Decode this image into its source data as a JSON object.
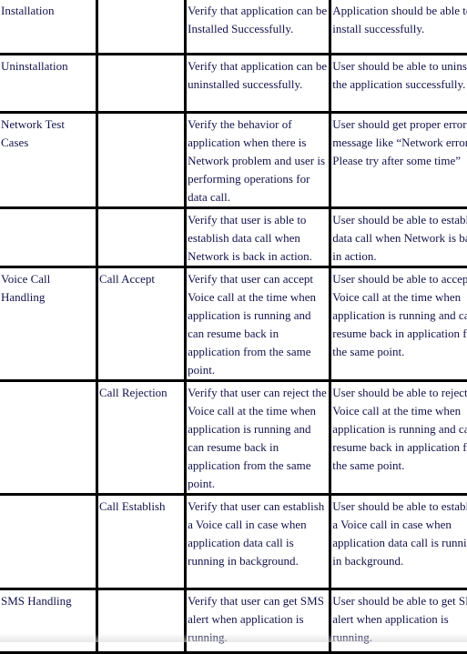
{
  "table": {
    "rows": [
      {
        "module": "Installation",
        "sub": "",
        "test": "Verify that application can be Installed Successfully.",
        "expected": "Application should be able to install successfully."
      },
      {
        "module": "Uninstallation",
        "sub": "",
        "test": "Verify that application can be uninstalled successfully.",
        "expected": "User should be able to uninstall the application successfully."
      },
      {
        "module": "Network Test Cases",
        "sub": "",
        "test": "Verify the behavior of application when there is Network problem and user is performing operations for data call.",
        "expected": "User should get proper error message like “Network error. Please try after some time”"
      },
      {
        "module": "",
        "sub": "",
        "test": "Verify that user is able to establish data call when Network is back in action.",
        "expected": "User should be able to establish data call when Network is back in action."
      },
      {
        "module": "Voice Call Handling",
        "sub": "Call Accept",
        "test": "Verify that user can accept Voice call at the time when application is running and can resume back in application from the same point.",
        "expected": "User should be able to accept Voice call at the time when application is running and can resume back in application from the same point."
      },
      {
        "module": "",
        "sub": "Call Rejection",
        "test": "Verify that user can reject the Voice call at the time when application is running and can resume back in application from the same point.",
        "expected": "User should be able to reject the Voice call at the time when application is running and can resume back in application from the same point."
      },
      {
        "module": "",
        "sub": "Call Establish",
        "test": "Verify that user can establish a Voice call in case when application data call is running in background.",
        "expected": "User should be able to establish a Voice call in case when application data call is running in background."
      },
      {
        "module": "SMS Handling",
        "sub": "",
        "test": "Verify that user can get SMS alert when application is running.",
        "expected": "User should be able to get SMS alert when application is running."
      }
    ]
  }
}
